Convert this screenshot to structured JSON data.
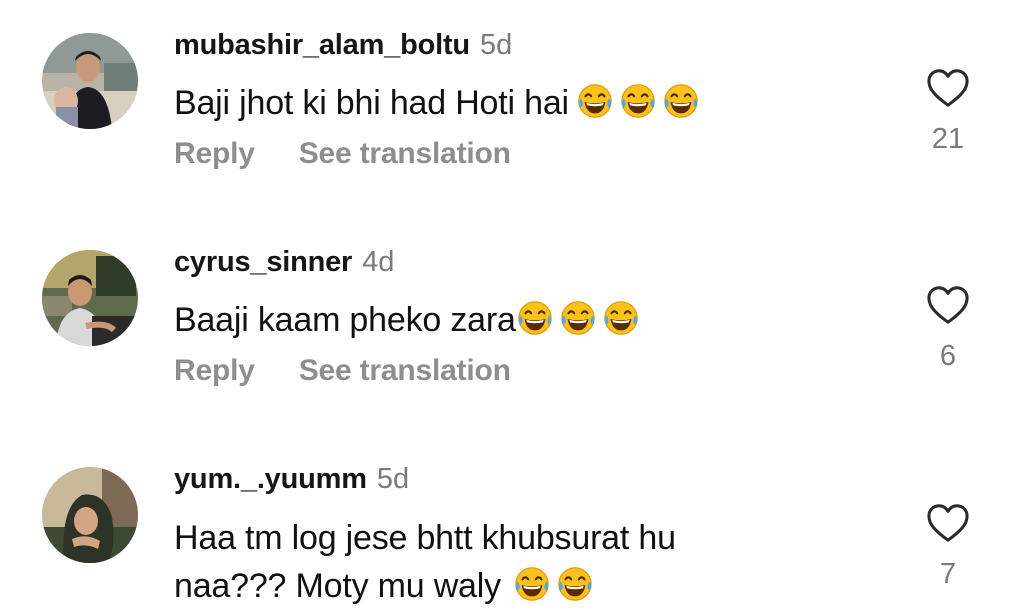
{
  "actions": {
    "reply_label": "Reply",
    "translate_label": "See translation"
  },
  "icons": {
    "heart": "heart-outline-icon",
    "emoji": "face-with-tears-of-joy-emoji"
  },
  "comments": [
    {
      "username": "mubashir_alam_boltu",
      "time": "5d",
      "text": "Baji jhot ki bhi had Hoti hai",
      "emoji_count": 3,
      "likes": "21"
    },
    {
      "username": "cyrus_sinner",
      "time": "4d",
      "text": "Baaji kaam pheko zara",
      "emoji_count": 3,
      "likes": "6"
    },
    {
      "username": "yum._.yuumm",
      "time": "5d",
      "text_line1": "Haa tm log jese bhtt khubsurat hu",
      "text_line2": "naa??? Moty mu waly",
      "emoji_count": 2,
      "likes": "7"
    }
  ]
}
